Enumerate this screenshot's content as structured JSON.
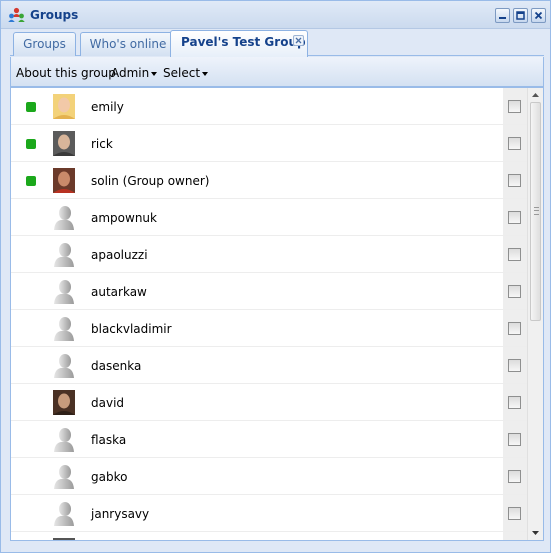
{
  "window": {
    "title": "Groups",
    "icon": "groups-people-icon"
  },
  "window_buttons": [
    "minimize-icon",
    "maximize-icon",
    "close-icon"
  ],
  "tabs": [
    {
      "label": "Groups",
      "active": false
    },
    {
      "label": "Who's online",
      "active": false
    },
    {
      "label": "Pavel's Test Group",
      "active": true,
      "closable": true
    }
  ],
  "toolbar": {
    "about_label": "About this group",
    "admin_label": "Admin",
    "select_label": "Select"
  },
  "colors": {
    "online": "#1ba81b",
    "accent": "#15428b"
  },
  "members": [
    {
      "name": "emily",
      "online": true,
      "avatar": "photo-blonde-woman"
    },
    {
      "name": "rick",
      "online": true,
      "avatar": "photo-man"
    },
    {
      "name": "solin (Group owner)",
      "online": true,
      "avatar": "photo-man-red"
    },
    {
      "name": "ampownuk",
      "online": false,
      "avatar": "default-user"
    },
    {
      "name": "apaoluzzi",
      "online": false,
      "avatar": "default-user"
    },
    {
      "name": "autarkaw",
      "online": false,
      "avatar": "default-user"
    },
    {
      "name": "blackvladimir",
      "online": false,
      "avatar": "default-user"
    },
    {
      "name": "dasenka",
      "online": false,
      "avatar": "default-user"
    },
    {
      "name": "david",
      "online": false,
      "avatar": "photo-man-dark"
    },
    {
      "name": "flaska",
      "online": false,
      "avatar": "default-user"
    },
    {
      "name": "gabko",
      "online": false,
      "avatar": "default-user"
    },
    {
      "name": "janrysavy",
      "online": false,
      "avatar": "default-user"
    },
    {
      "name": "",
      "online": false,
      "avatar": "photo-partial"
    }
  ]
}
